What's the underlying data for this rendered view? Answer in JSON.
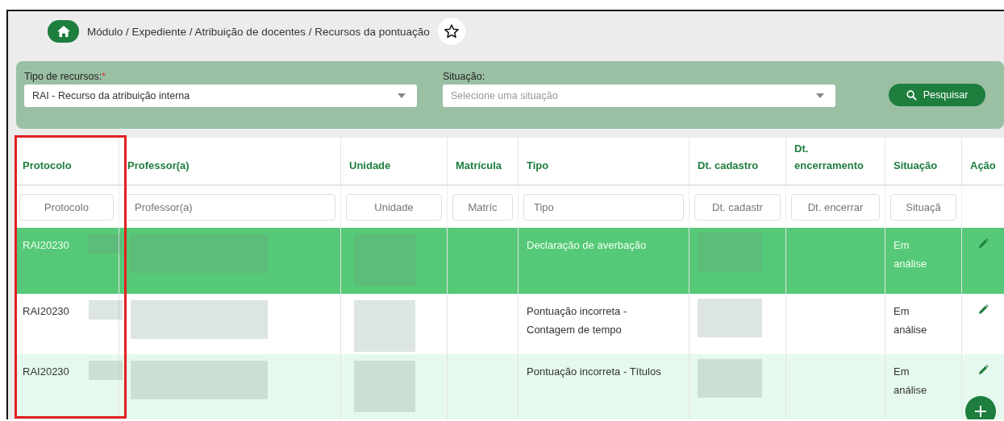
{
  "breadcrumb": "Módulo / Expediente / Atribuição de docentes / Recursos da pontuação",
  "favorite": false,
  "filters": {
    "tipo": {
      "label": "Tipo de recursos:",
      "required_mark": "*",
      "value": "RAI - Recurso da atribuição interna"
    },
    "situacao": {
      "label": "Situação:",
      "placeholder": "Selecione uma situação"
    },
    "search_button": "Pesquisar"
  },
  "table": {
    "columns": [
      {
        "label": "Protocolo",
        "placeholder": "Protocolo"
      },
      {
        "label": "Professor(a)",
        "placeholder": "Professor(a)"
      },
      {
        "label": "Unidade",
        "placeholder": "Unidade"
      },
      {
        "label": "Matrícula",
        "placeholder": "Matríc"
      },
      {
        "label": "Tipo",
        "placeholder": "Tipo"
      },
      {
        "label": "Dt. cadastro",
        "placeholder": "Dt. cadastr"
      },
      {
        "label": "Dt. encerramento",
        "placeholder": "Dt. encerrar"
      },
      {
        "label": "Situação",
        "placeholder": "Situaçã"
      },
      {
        "label": "Ação"
      }
    ],
    "rows": [
      {
        "selected": true,
        "protocolo": "RAI20230",
        "tipo": "Declaração de averbação",
        "situacao": "Em análise"
      },
      {
        "selected": false,
        "protocolo": "RAI20230",
        "tipo": "Pontuação incorreta - Contagem de tempo",
        "situacao": "Em análise"
      },
      {
        "selected": false,
        "protocolo": "RAI20230",
        "tipo": "Pontuação incorreta - Títulos",
        "situacao": "Em análise"
      }
    ]
  }
}
